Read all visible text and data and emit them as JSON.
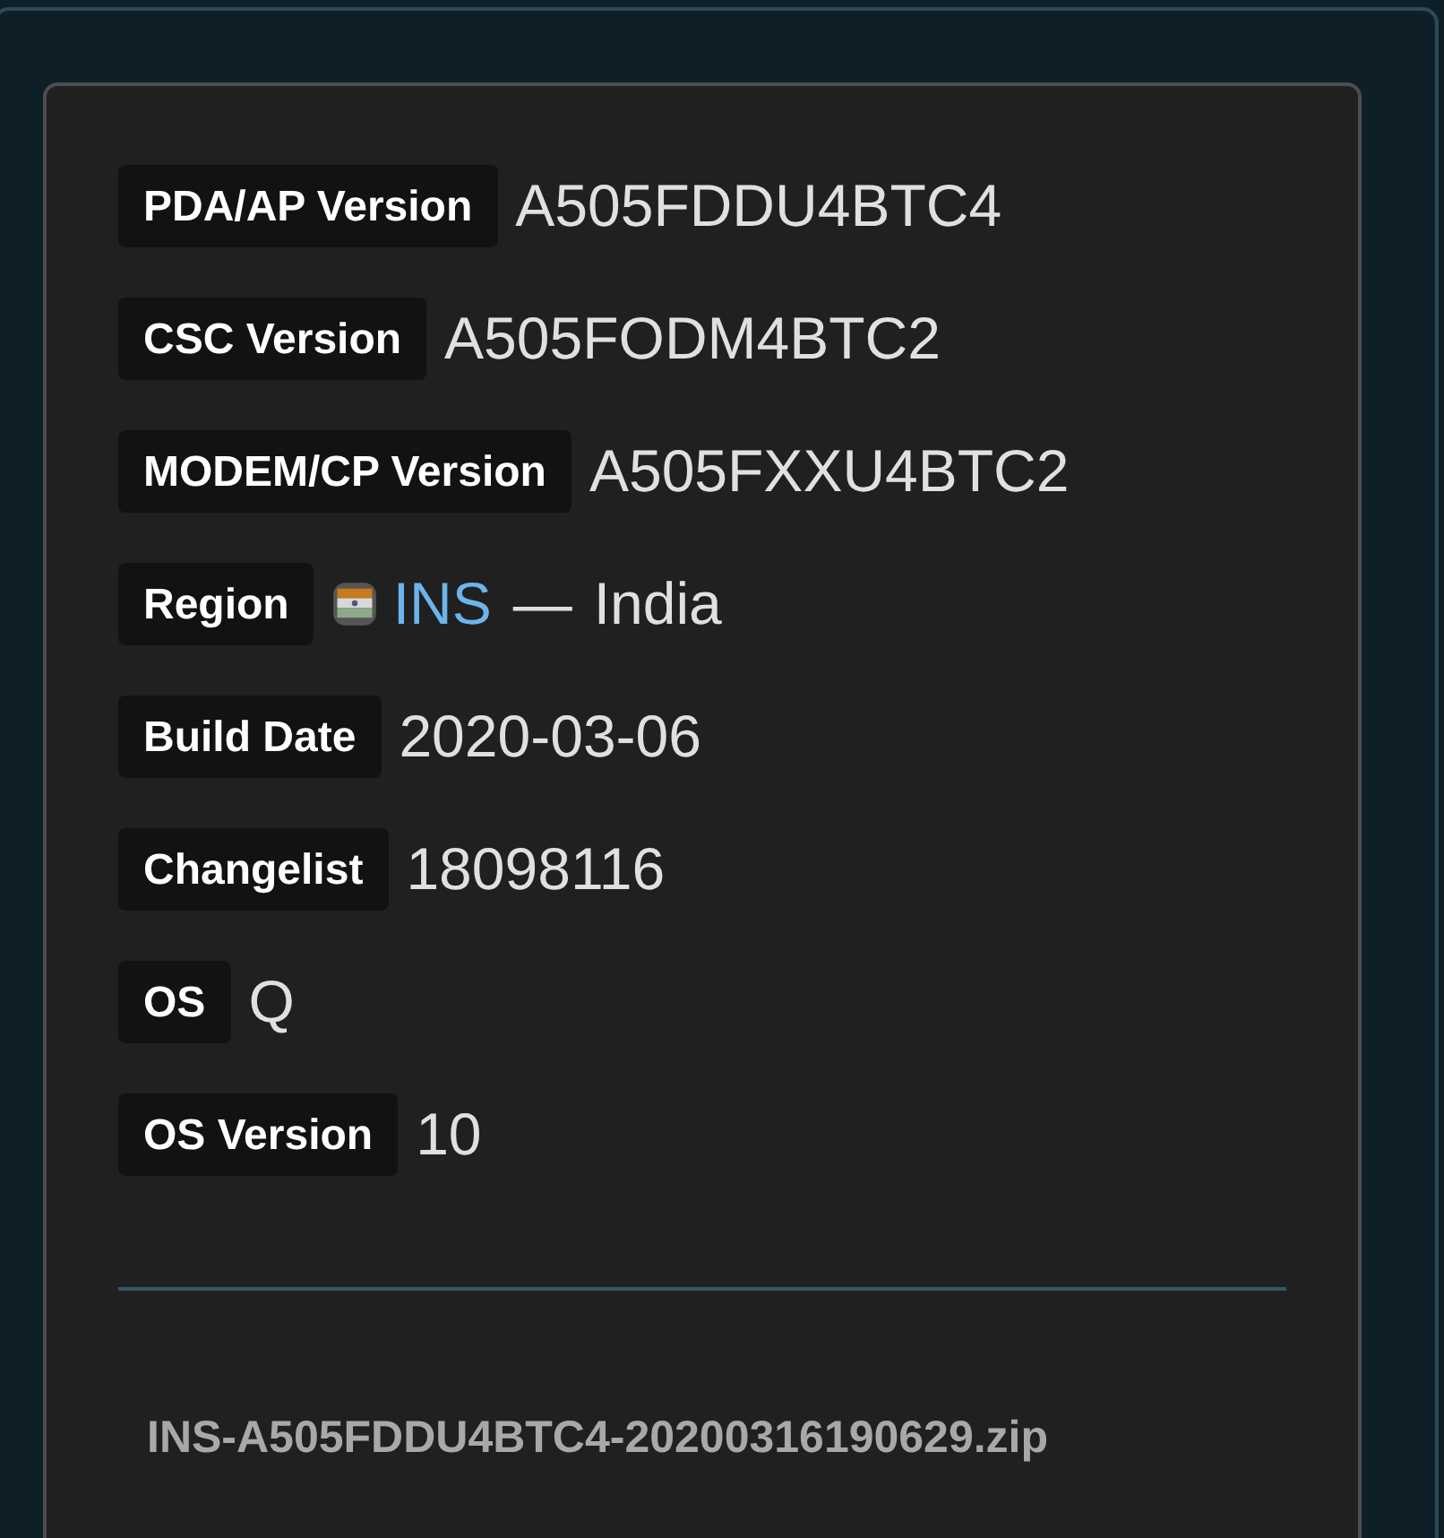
{
  "details": [
    {
      "kind": "text",
      "label": "PDA/AP Version",
      "value": "A505FDDU4BTC4"
    },
    {
      "kind": "text",
      "label": "CSC Version",
      "value": "A505FODM4BTC2"
    },
    {
      "kind": "text",
      "label": "MODEM/CP Version",
      "value": "A505FXXU4BTC2"
    },
    {
      "kind": "region",
      "label": "Region",
      "code": "INS",
      "separator": "—",
      "country": "India"
    },
    {
      "kind": "text",
      "label": "Build Date",
      "value": "2020-03-06"
    },
    {
      "kind": "text",
      "label": "Changelist",
      "value": "18098116"
    },
    {
      "kind": "text",
      "label": "OS",
      "value": "Q"
    },
    {
      "kind": "text",
      "label": "OS Version",
      "value": "10"
    }
  ],
  "file_name": "INS-A505FDDU4BTC4-20200316190629.zip"
}
